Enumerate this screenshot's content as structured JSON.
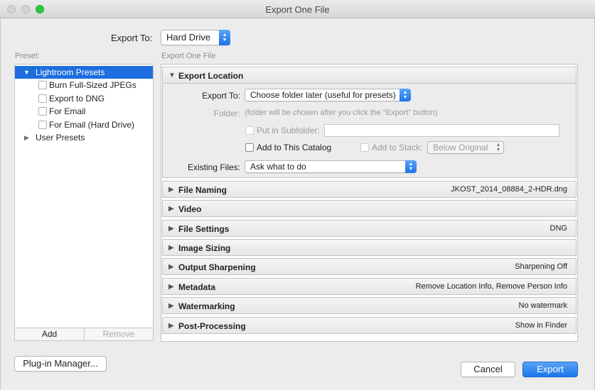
{
  "window": {
    "title": "Export One File"
  },
  "export_to": {
    "label": "Export To:",
    "value": "Hard Drive"
  },
  "presets": {
    "label": "Preset:",
    "items": [
      {
        "label": "Lightroom Presets"
      },
      {
        "label": "Burn Full-Sized JPEGs"
      },
      {
        "label": "Export to DNG"
      },
      {
        "label": "For Email"
      },
      {
        "label": "For Email (Hard Drive)"
      },
      {
        "label": "User Presets"
      }
    ],
    "add_label": "Add",
    "remove_label": "Remove"
  },
  "panel": {
    "label": "Export One File",
    "export_location": {
      "title": "Export Location",
      "export_to_label": "Export To:",
      "export_to_value": "Choose folder later (useful for presets)",
      "folder_label": "Folder:",
      "folder_note": "(folder will be chosen after you click the “Export” button)",
      "put_in_subfolder": "Put in Subfolder:",
      "add_to_catalog": "Add to This Catalog",
      "add_to_stack": "Add to Stack:",
      "stack_value": "Below Original",
      "existing_files_label": "Existing Files:",
      "existing_files_value": "Ask what to do"
    },
    "sections": [
      {
        "title": "File Naming",
        "summary": "JKOST_2014_08884_2-HDR.dng"
      },
      {
        "title": "Video",
        "summary": ""
      },
      {
        "title": "File Settings",
        "summary": "DNG"
      },
      {
        "title": "Image Sizing",
        "summary": ""
      },
      {
        "title": "Output Sharpening",
        "summary": "Sharpening Off"
      },
      {
        "title": "Metadata",
        "summary": "Remove Location Info, Remove Person Info"
      },
      {
        "title": "Watermarking",
        "summary": "No watermark"
      },
      {
        "title": "Post-Processing",
        "summary": "Show in Finder"
      }
    ]
  },
  "buttons": {
    "plugin_manager": "Plug-in Manager...",
    "cancel": "Cancel",
    "export": "Export"
  }
}
